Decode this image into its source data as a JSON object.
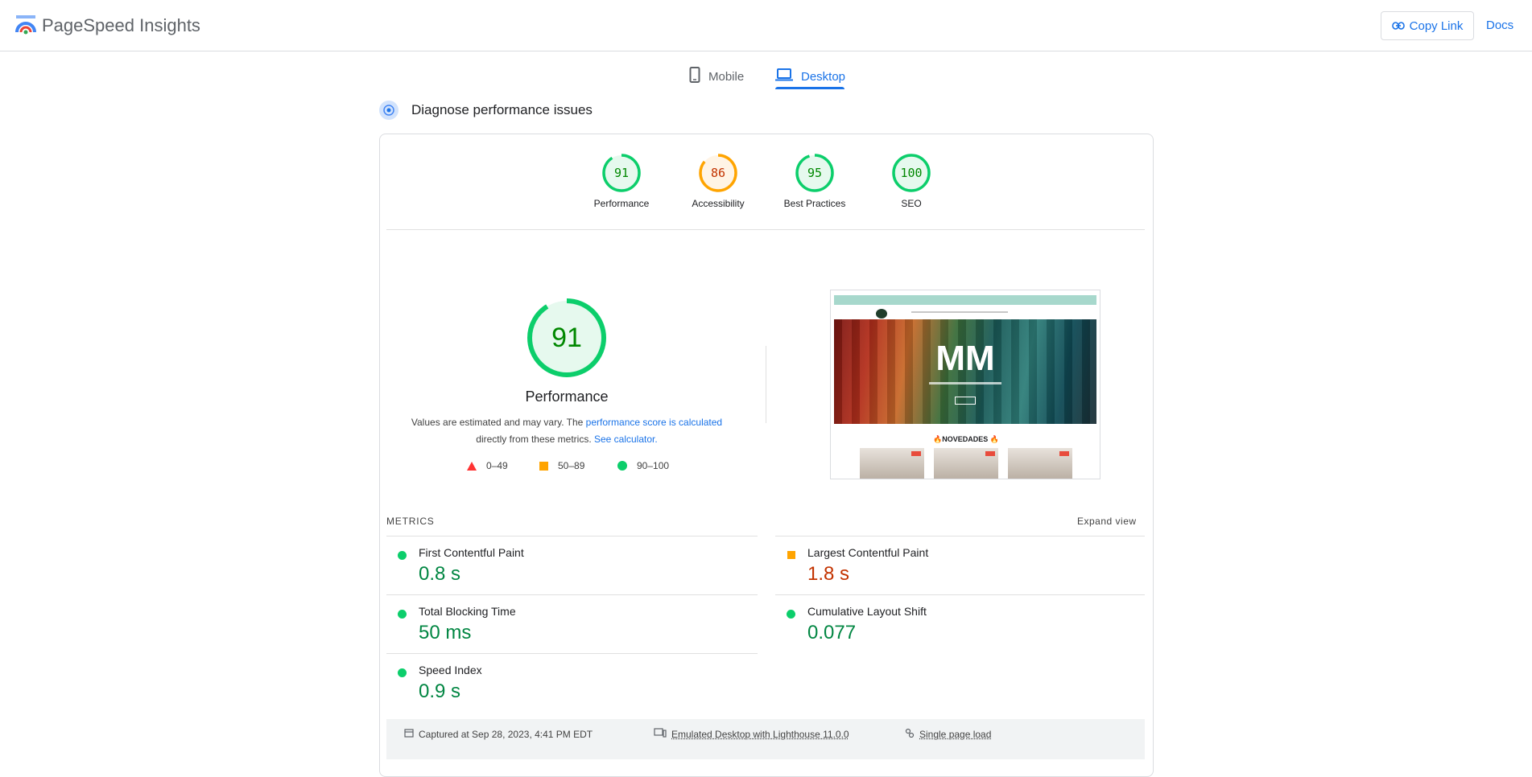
{
  "header": {
    "brand": "PageSpeed Insights",
    "copy_link": "Copy Link",
    "docs": "Docs"
  },
  "tabs": [
    {
      "label": "Mobile",
      "icon": "phone-icon",
      "active": false
    },
    {
      "label": "Desktop",
      "icon": "laptop-icon",
      "active": true
    }
  ],
  "diagnose": {
    "title": "Diagnose performance issues"
  },
  "scores": [
    {
      "value": "91",
      "label": "Performance",
      "fraction": 0.91,
      "color": "#0cce6b",
      "text_color": "#008800",
      "bg": "#e6f9ee"
    },
    {
      "value": "86",
      "label": "Accessibility",
      "fraction": 0.86,
      "color": "#ffa400",
      "text_color": "#c33300",
      "bg": "#fff4e5"
    },
    {
      "value": "95",
      "label": "Best Practices",
      "fraction": 0.95,
      "color": "#0cce6b",
      "text_color": "#008800",
      "bg": "#e6f9ee"
    },
    {
      "value": "100",
      "label": "SEO",
      "fraction": 1.0,
      "color": "#0cce6b",
      "text_color": "#008800",
      "bg": "#e6f9ee"
    }
  ],
  "performance": {
    "score": "91",
    "fraction": 0.91,
    "title": "Performance",
    "note_pre": "Values are estimated and may vary. The ",
    "note_link1": "performance score is calculated",
    "note_mid": " directly from these metrics. ",
    "note_link2": "See calculator."
  },
  "legend": [
    {
      "range": "0–49",
      "shape": "triangle",
      "color": "#ff3333"
    },
    {
      "range": "50–89",
      "shape": "square",
      "color": "#ffa400"
    },
    {
      "range": "90–100",
      "shape": "circle",
      "color": "#0cce6b"
    }
  ],
  "thumbnail": {
    "hero_text": "MM",
    "section_title": "🔥NOVEDADES 🔥"
  },
  "metrics": {
    "label": "METRICS",
    "expand": "Expand view",
    "items": [
      {
        "name": "First Contentful Paint",
        "value": "0.8 s",
        "status": "good"
      },
      {
        "name": "Largest Contentful Paint",
        "value": "1.8 s",
        "status": "average"
      },
      {
        "name": "Total Blocking Time",
        "value": "50 ms",
        "status": "good"
      },
      {
        "name": "Cumulative Layout Shift",
        "value": "0.077",
        "status": "good"
      },
      {
        "name": "Speed Index",
        "value": "0.9 s",
        "status": "good"
      }
    ]
  },
  "footer": {
    "captured": "Captured at Sep 28, 2023, 4:41 PM EDT",
    "emulated": "Emulated Desktop with Lighthouse 11.0.0",
    "single": "Single page load"
  }
}
